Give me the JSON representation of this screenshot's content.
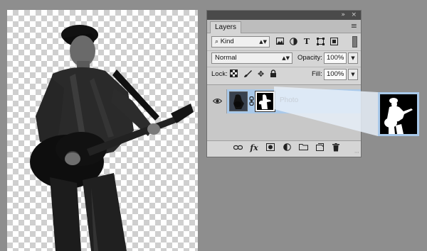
{
  "panel": {
    "title_tab": "Layers",
    "collapse_glyph": "»",
    "close_glyph": "×",
    "menu_glyph": "≡",
    "filter": {
      "search_glyph": "⌕",
      "kind_label": "Kind",
      "icons": [
        "image-icon",
        "adjustment-icon",
        "type-icon",
        "shape-icon",
        "smart-object-icon"
      ]
    },
    "blend_mode": "Normal",
    "opacity_label": "Opacity:",
    "opacity_value": "100%",
    "lock_label": "Lock:",
    "fill_label": "Fill:",
    "fill_value": "100%",
    "layer": {
      "name": "Photo",
      "visible": true,
      "selected_color": "#a9c9ea"
    },
    "bottom_icons": [
      "link-layers-icon",
      "fx-icon",
      "add-mask-icon",
      "adjustment-layer-icon",
      "new-group-icon",
      "new-layer-icon",
      "trash-icon"
    ],
    "fx_label": "fx"
  },
  "colors": {
    "background": "#8e8e8e",
    "panel_bg": "#d5d5d5",
    "selection": "#a9c9ea"
  }
}
